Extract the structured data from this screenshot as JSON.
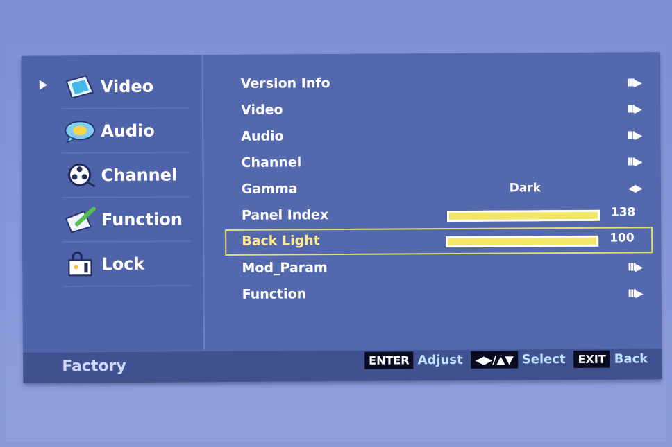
{
  "sidebar": {
    "items": [
      {
        "label": "Video",
        "icon": "video-icon"
      },
      {
        "label": "Audio",
        "icon": "audio-icon"
      },
      {
        "label": "Channel",
        "icon": "channel-reel-icon"
      },
      {
        "label": "Function",
        "icon": "function-pen-icon"
      },
      {
        "label": "Lock",
        "icon": "lock-icon"
      }
    ],
    "active_index": 0
  },
  "menu": {
    "rows": [
      {
        "label": "Version Info",
        "arrow": "III▶"
      },
      {
        "label": "Video",
        "arrow": "III▶"
      },
      {
        "label": "Audio",
        "arrow": "III▶"
      },
      {
        "label": "Channel",
        "arrow": "III▶"
      },
      {
        "label": "Gamma",
        "value": "Dark",
        "arrow": "◀▶"
      },
      {
        "label": "Panel Index",
        "value": "138",
        "fraction": 1.0
      },
      {
        "label": "Back Light",
        "value": "100",
        "fraction": 1.0
      },
      {
        "label": "Mod_Param",
        "arrow": "III▶"
      },
      {
        "label": "Function",
        "arrow": "III▶"
      }
    ],
    "selected_index": 6
  },
  "footer": {
    "label": "Factory",
    "hints": [
      {
        "key": "ENTER",
        "desc": "Adjust"
      },
      {
        "key": "◀▶/▲▼",
        "desc": "Select"
      },
      {
        "key": "EXIT",
        "desc": "Back"
      }
    ]
  },
  "colors": {
    "osd_bg": "#5468ae",
    "highlight": "#e1df72",
    "bar": "#f2e668"
  }
}
